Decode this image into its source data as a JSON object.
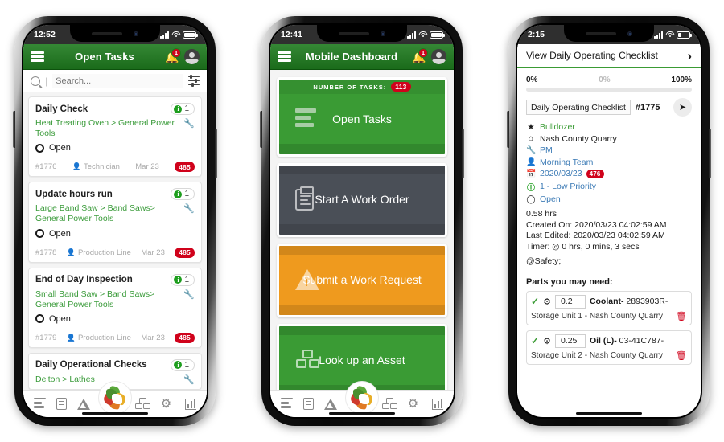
{
  "phone1": {
    "status": {
      "time": "12:52"
    },
    "header": {
      "title": "Open Tasks",
      "notification_count": "1",
      "menu_icon": "hamburger-icon",
      "bell_icon": "bell-icon",
      "avatar_icon": "user-avatar-icon"
    },
    "search": {
      "placeholder": "Search...",
      "value": "",
      "filter_icon": "filter-sliders-icon"
    },
    "tasks": [
      {
        "title": "Daily Check",
        "count": "1",
        "path": "Heat Treating Oven > General Power Tools",
        "status": "Open",
        "id": "#1776",
        "assignee": "Technician",
        "date": "Mar 23",
        "badge": "485"
      },
      {
        "title": "Update hours run",
        "count": "1",
        "path": "Large Band Saw > Band Saws> General Power Tools",
        "status": "Open",
        "id": "#1778",
        "assignee": "Production Line",
        "date": "Mar 23",
        "badge": "485"
      },
      {
        "title": "End of Day Inspection",
        "count": "1",
        "path": "Small Band Saw > Band Saws> General Power Tools",
        "status": "Open",
        "id": "#1779",
        "assignee": "Production Line",
        "date": "Mar 23",
        "badge": "485"
      },
      {
        "title": "Daily Operational Checks",
        "count": "1",
        "path": "Delton > Lathes",
        "status": "",
        "id": "",
        "assignee": "",
        "date": "",
        "badge": ""
      }
    ]
  },
  "phone2": {
    "status": {
      "time": "12:41"
    },
    "header": {
      "title": "Mobile Dashboard",
      "notification_count": "1",
      "menu_icon": "hamburger-icon",
      "bell_icon": "bell-icon",
      "avatar_icon": "user-avatar-icon"
    },
    "cards": [
      {
        "ribbon": "NUMBER OF TASKS:",
        "badge": "113",
        "label": "Open Tasks",
        "color": "#3a9b34",
        "icon": "list-lines-icon"
      },
      {
        "ribbon": "",
        "badge": "",
        "label": "Start A Work Order",
        "color": "#4a4f57",
        "icon": "clipboard-icon"
      },
      {
        "ribbon": "",
        "badge": "",
        "label": "Submit a Work Request",
        "color": "#ef9a1e",
        "icon": "warning-triangle-icon"
      },
      {
        "ribbon": "",
        "badge": "",
        "label": "Look up an Asset",
        "color": "#3a9b34",
        "icon": "boxes-icon"
      },
      {
        "ribbon": "",
        "badge": "",
        "label": "",
        "color": "#3b3173",
        "icon": ""
      }
    ]
  },
  "phone3": {
    "status": {
      "time": "2:15"
    },
    "header": {
      "title": "View Daily Operating Checklist",
      "chevron_icon": "chevron-right-icon"
    },
    "progress": {
      "left": "0%",
      "mid": "0%",
      "right": "100%",
      "value": 0
    },
    "checklist": {
      "name": "Daily Operating Checklist",
      "id": "#1775",
      "share_icon": "share-arrow-icon"
    },
    "meta": [
      {
        "icon": "asset-icon",
        "text": "Bulldozer",
        "color": "green",
        "badge": ""
      },
      {
        "icon": "home-icon",
        "text": "Nash County Quarry",
        "color": "black",
        "badge": ""
      },
      {
        "icon": "wrench-icon",
        "text": "PM",
        "color": "blue",
        "badge": ""
      },
      {
        "icon": "person-icon",
        "text": "Morning Team",
        "color": "blue",
        "badge": ""
      },
      {
        "icon": "calendar-icon",
        "text": "2020/03/23",
        "color": "blue",
        "badge": "476"
      },
      {
        "icon": "info-circle-icon",
        "text": "1 - Low Priority",
        "color": "blue",
        "badge": ""
      },
      {
        "icon": "status-ring-icon",
        "text": "Open",
        "color": "blue",
        "badge": ""
      }
    ],
    "details": [
      "0.58 hrs",
      "Created On: 2020/03/23 04:02:59 AM",
      "Last Edited: 2020/03/23 04:02:59 AM",
      "Timer: ◎ 0 hrs, 0 mins, 3 secs"
    ],
    "tag": "@Safety;",
    "parts_title": "Parts you may need:",
    "parts": [
      {
        "qty": "0.2",
        "name_bold": "Coolant-",
        "name_rest": " 2893903R-",
        "location": "Storage Unit 1 - Nash County Quarry",
        "check_icon": "check-icon",
        "gear_icon": "gear-icon",
        "delete_icon": "trash-icon"
      },
      {
        "qty": "0.25",
        "name_bold": "Oil (L)-",
        "name_rest": " 03-41C787-",
        "location": "Storage Unit 2 - Nash County Quarry",
        "check_icon": "check-icon",
        "gear_icon": "gear-icon",
        "delete_icon": "trash-icon"
      }
    ]
  },
  "bottom_nav": {
    "items": [
      {
        "icon": "list-lines-icon"
      },
      {
        "icon": "clipboard-icon"
      },
      {
        "icon": "warning-triangle-icon"
      },
      {
        "icon": "app-logo-gear-icon"
      },
      {
        "icon": "boxes-icon"
      },
      {
        "icon": "gears-settings-icon"
      },
      {
        "icon": "bar-chart-icon"
      }
    ]
  },
  "colors": {
    "brand_green": "#1e7a1e",
    "card_green": "#3a9b34",
    "dark_gray": "#4a4f57",
    "orange": "#ef9a1e",
    "purple": "#3b3173",
    "red_badge": "#d0021b",
    "link_blue": "#3b7ab5"
  }
}
